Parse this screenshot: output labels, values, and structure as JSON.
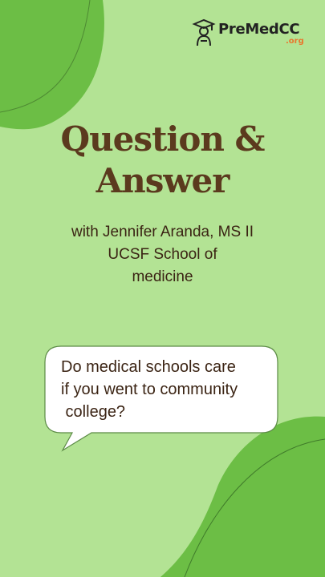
{
  "logo": {
    "name": "PreMedCC",
    "suffix": ".org",
    "icon": "scholar-icon"
  },
  "title": {
    "line1": "Question &",
    "line2": "Answer"
  },
  "subtitle": {
    "line1": "with Jennifer Aranda,  MS II",
    "line2": "UCSF School of",
    "line3": "medicine"
  },
  "question": {
    "line1": "Do medical schools care",
    "line2": "if you went to community",
    "line3": " college?"
  },
  "colors": {
    "background": "#b3e394",
    "blob": "#6cbe45",
    "title": "#5b3a1e",
    "accent": "#e8772e"
  }
}
